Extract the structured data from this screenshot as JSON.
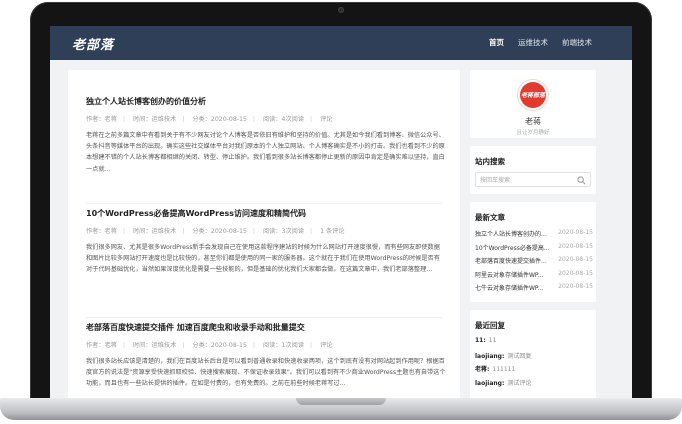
{
  "site": {
    "logo": "老部落",
    "nav": [
      {
        "label": "首页",
        "active": true
      },
      {
        "label": "运维技术",
        "active": false
      },
      {
        "label": "前端技术",
        "active": false
      }
    ]
  },
  "posts": [
    {
      "title": "独立个人站长博客创办的价值分析",
      "author": "作者：老蒋",
      "category": "时间：运维技术",
      "date": "分类：2020-08-15",
      "views": "阅读：4次阅读",
      "comments": "评论",
      "excerpt": "老蒋在之前多篇文章中有看到关于有不少网友讨论个人博客是否依旧有维护和坚持的价值。尤其是如今我们看到博客、微信公众号、头条抖音等媒体平台的出现。确实这些社交媒体平台对我们原本的个人独立网站、个人博客确实是不小的打击。我们也看到不少的原本想建不错的个人站长博客都相继的关闭、转型、停止维护。我们看到很多站长博客都停止更新的原因中肯定是确实难以坚持，直白一点就..."
    },
    {
      "title": "10个WordPress必备提高WordPress访问速度和精简代码",
      "author": "作者：老蒋",
      "category": "时间：运维技术",
      "date": "分类：2020-08-15",
      "views": "阅读：3次阅读",
      "comments": "1 条评论",
      "excerpt": "我们很多网友、尤其是很多WordPress新手会发现自己在使用这款程序建站的时候为什么网站打开速度很慢，而有些网友即使数据和图片比较多网站打开速度也是比较快的，甚至你们都是使用的同一家的服务器。这个就在于我们在使用WordPress的时候是否有对于代码基础优化，当然如果深度优化是需要一些技能的，但是基础的优化我们大家都会做。在这篇文章中，我们老部落整理..."
    },
    {
      "title": "老部落百度快速提交插件 加速百度爬虫和收录手动和批量提交",
      "author": "作者：老蒋",
      "category": "时间：运维技术",
      "date": "分类：2020-08-15",
      "views": "阅读：1次阅读",
      "comments": "评论",
      "excerpt": "我们很多站长应该是清楚的，我们在百度站长后台是可以看到普通收录和快速收录两项，这个到底有没有对网站起到作用呢？根据百度官方的说法是\"资源享受快速抓取校验、快速搜索展现、不保证收录效果\"。我们可以看到有不少商业WordPress主题也有自带这个功能，而且也有一些站长提供的插件。在如是付费的，也有免费的。之前在前些时候老蒋写过..."
    }
  ],
  "sidebar": {
    "avatar_text": "老蒋部落",
    "author_name": "老蒋",
    "author_sub": "且让岁月静好",
    "search_title": "站内搜索",
    "search_placeholder": "按回车搜索",
    "recent_title": "最新文章",
    "recent": [
      {
        "title": "独立个人站长博客创办的...",
        "date": "2020-08-15"
      },
      {
        "title": "10个WordPress必备提高...",
        "date": "2020-08-15"
      },
      {
        "title": "老部落百度快速提交插件...",
        "date": "2020-08-15"
      },
      {
        "title": "阿里云对象存储插件WP...",
        "date": "2020-08-15"
      },
      {
        "title": "七牛云对象存储插件WP...",
        "date": "2020-08-15"
      }
    ],
    "replies_title": "最近回复",
    "replies": [
      {
        "who": "11:",
        "what": "11"
      },
      {
        "who": "laojiang:",
        "what": "测试回复"
      },
      {
        "who": "老蒋:",
        "what": "111111"
      },
      {
        "who": "laojiang:",
        "what": "测试评论"
      }
    ]
  },
  "colors": {
    "header": "#2f3f57",
    "accent": "#e23a2e",
    "background": "#f1f2f4"
  }
}
